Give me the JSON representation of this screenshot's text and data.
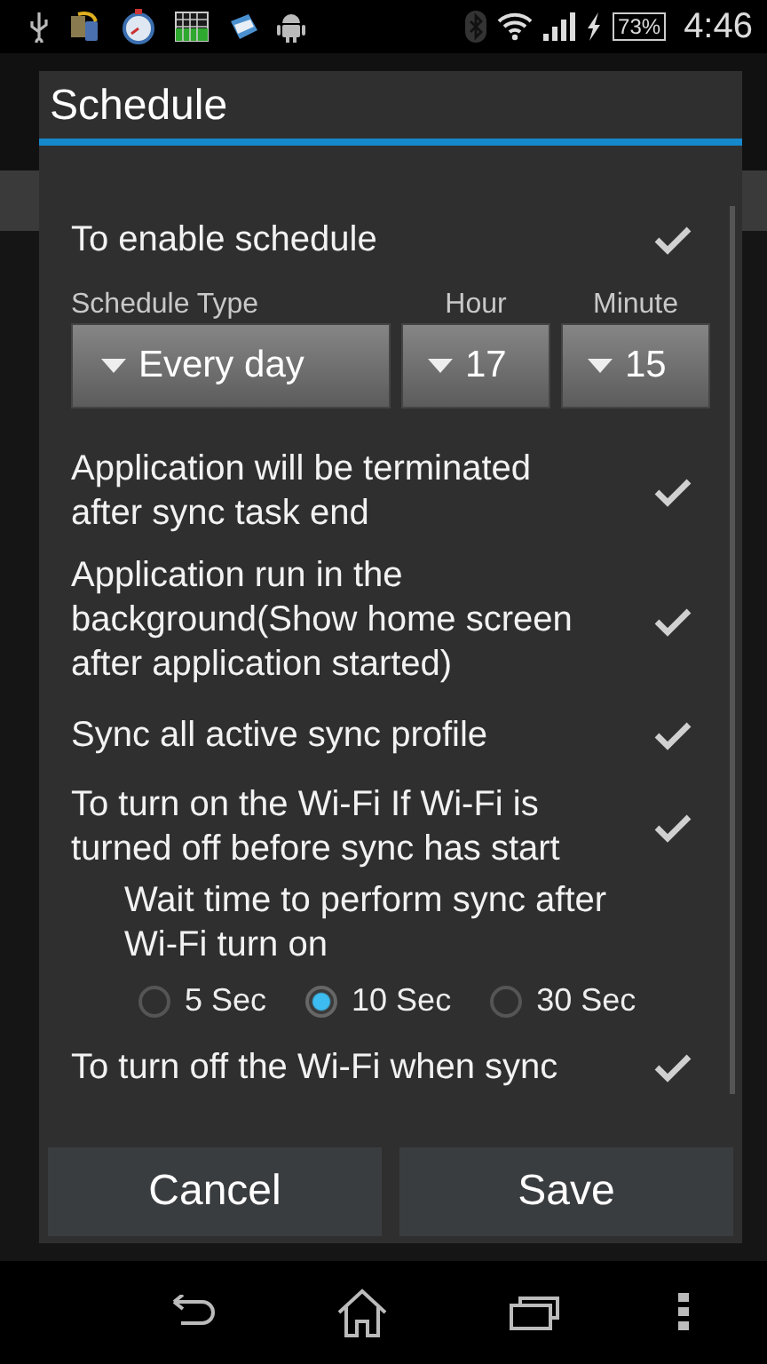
{
  "status_bar": {
    "battery": "73%",
    "time": "4:46"
  },
  "dialog": {
    "title": "Schedule",
    "items": [
      {
        "kind": "check",
        "label": "To enable schedule",
        "checked": true
      },
      {
        "kind": "pickers",
        "pickers": [
          {
            "label": "Schedule Type",
            "value": "Every day"
          },
          {
            "label": "Hour",
            "value": "17"
          },
          {
            "label": "Minute",
            "value": "15"
          }
        ]
      },
      {
        "kind": "check",
        "label": "Application will be terminated after sync task end",
        "checked": true
      },
      {
        "kind": "check",
        "label": "Application run in the background(Show home screen after application started)",
        "checked": true
      },
      {
        "kind": "check",
        "label": "Sync all active sync profile",
        "checked": true
      },
      {
        "kind": "check",
        "label": "To turn on the Wi-Fi If Wi-Fi is turned off before sync has start",
        "checked": true
      },
      {
        "kind": "radio",
        "label": "Wait time to perform sync after Wi-Fi turn on",
        "choices": [
          {
            "label": "5 Sec",
            "selected": false
          },
          {
            "label": "10 Sec",
            "selected": true
          },
          {
            "label": "30 Sec",
            "selected": false
          }
        ]
      },
      {
        "kind": "check",
        "label": "To turn off the Wi-Fi when sync",
        "checked": true
      }
    ],
    "buttons": [
      "Cancel",
      "Save"
    ]
  }
}
